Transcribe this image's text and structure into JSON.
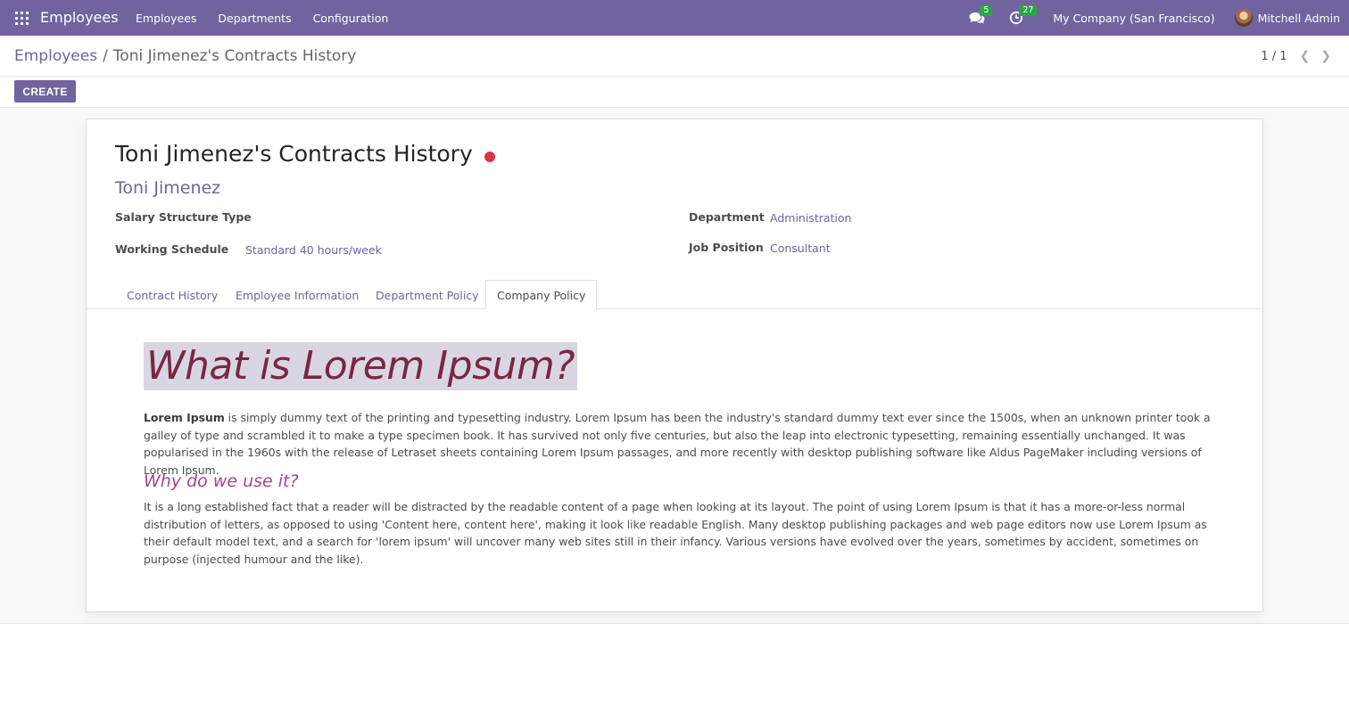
{
  "navbar": {
    "brand": "Employees",
    "menu": [
      "Employees",
      "Departments",
      "Configuration"
    ],
    "messages_count": "5",
    "activities_count": "27",
    "company": "My Company (San Francisco)",
    "user": "Mitchell Admin",
    "accent": "#71639e"
  },
  "control": {
    "breadcrumb_root": "Employees",
    "breadcrumb_separator": "/",
    "breadcrumb_current": "Toni Jimenez's Contracts History",
    "pager": "1 / 1",
    "create_label": "CREATE"
  },
  "record": {
    "title": "Toni Jimenez's Contracts History",
    "employee": "Toni Jimenez",
    "fields": {
      "salary_structure_type_label": "Salary Structure Type",
      "salary_structure_type_value": "",
      "working_schedule_label": "Working Schedule",
      "working_schedule_value": "Standard 40 hours/week",
      "department_label": "Department",
      "department_value": "Administration",
      "job_position_label": "Job Position",
      "job_position_value": "Consultant"
    },
    "tabs": [
      "Contract History",
      "Employee Information",
      "Department Policy",
      "Company Policy"
    ],
    "active_tab": "Company Policy"
  },
  "policy": {
    "heading": "What is Lorem Ipsum?",
    "para1_bold": "Lorem Ipsum",
    "para1_rest": " is simply dummy text of the printing and typesetting industry. Lorem Ipsum has been the industry's standard dummy text ever since the 1500s, when an unknown printer took a galley of type and scrambled it to make a type specimen book. It has survived not only five centuries, but also the leap into electronic typesetting, remaining essentially unchanged. It was popularised in the 1960s with the release of Letraset sheets containing Lorem Ipsum passages, and more recently with desktop publishing software like Aldus PageMaker including versions of Lorem Ipsum.",
    "subheading": "Why do we use it?",
    "para2": "It is a long established fact that a reader will be distracted by the readable content of a page when looking at its layout. The point of using Lorem Ipsum is that it has a more-or-less normal distribution of letters, as opposed to using 'Content here, content here', making it look like readable English. Many desktop publishing packages and web page editors now use Lorem Ipsum as their default model text, and a search for 'lorem ipsum' will uncover many web sites still in their infancy. Various versions have evolved over the years, sometimes by accident, sometimes on purpose (injected humour and the like)."
  }
}
